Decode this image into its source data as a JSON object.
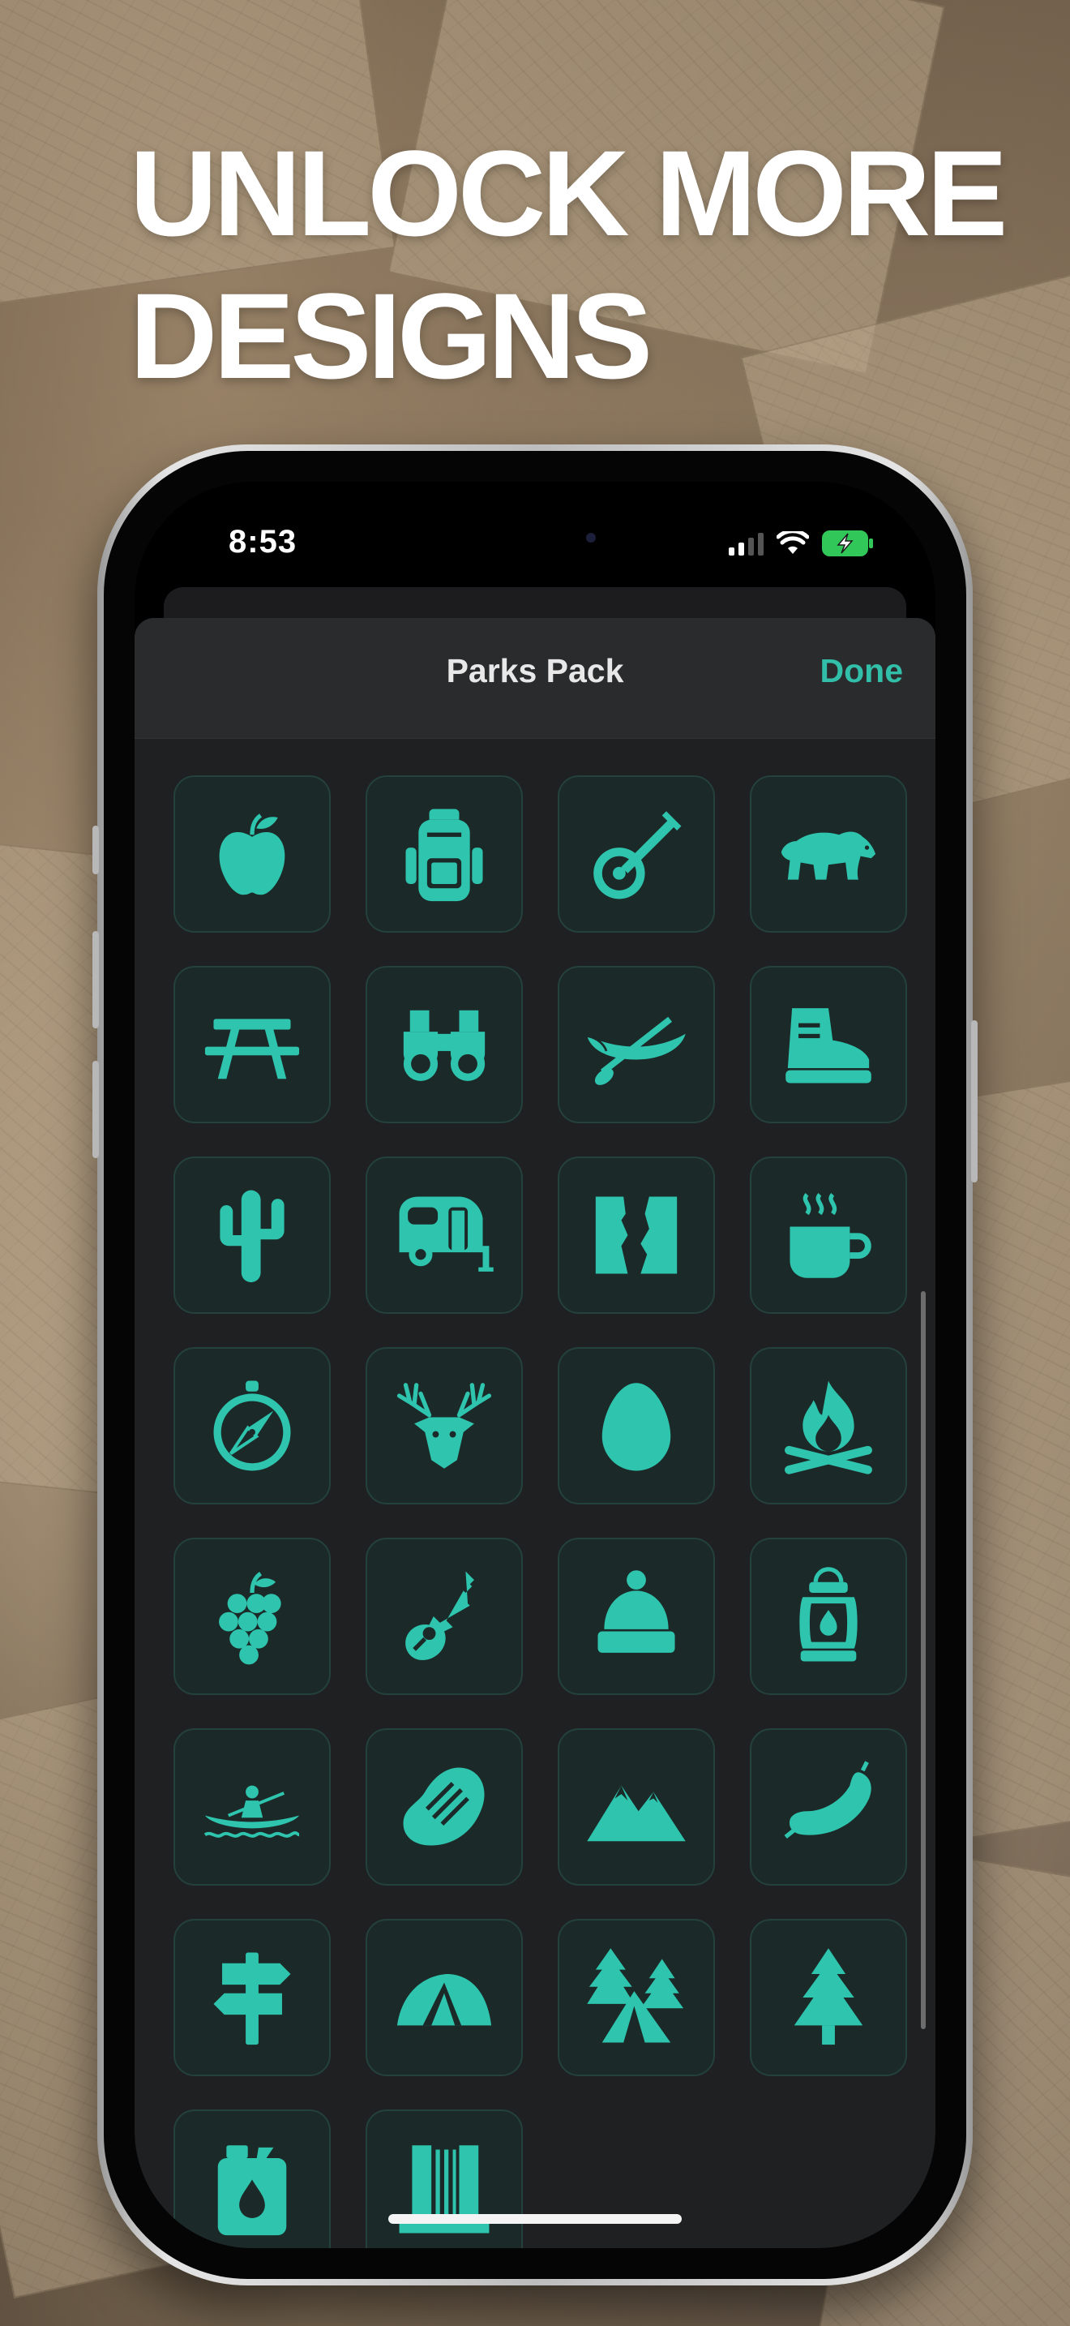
{
  "promo": {
    "headline_line1": "UNLOCK MORE",
    "headline_line2": "DESIGNS"
  },
  "status_bar": {
    "time": "8:53"
  },
  "sheet": {
    "title": "Parks Pack",
    "done_label": "Done",
    "accent_color": "#32bfa9"
  },
  "icons": [
    "apple-icon",
    "backpack-icon",
    "banjo-icon",
    "bear-icon",
    "picnic-table-icon",
    "binoculars-icon",
    "canoe-icon",
    "hiking-boot-icon",
    "cactus-icon",
    "camper-trailer-icon",
    "canyon-icon",
    "coffee-mug-icon",
    "compass-icon",
    "deer-icon",
    "egg-icon",
    "campfire-icon",
    "grapes-icon",
    "guitar-icon",
    "beanie-icon",
    "lantern-icon",
    "kayak-icon",
    "steak-icon",
    "mountains-icon",
    "sausage-icon",
    "signpost-icon",
    "dome-tent-icon",
    "forest-tent-icon",
    "pine-tree-icon",
    "fuel-can-icon",
    "waterfall-icon"
  ]
}
